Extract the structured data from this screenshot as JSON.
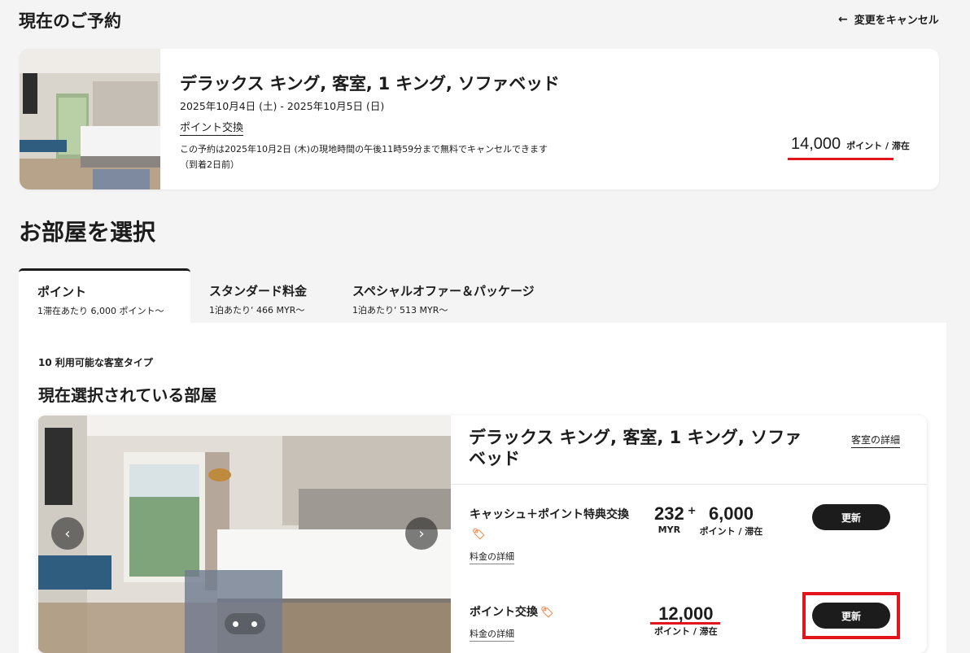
{
  "header": {
    "title": "現在のご予約",
    "cancel_label": "変更をキャンセル"
  },
  "reservation": {
    "room_name": "デラックス キング, 客室, 1 キング, ソファベッド",
    "dates": "2025年10月4日 (土) - 2025年10月5日 (日)",
    "rate_type": "ポイント交換",
    "policy": "この予約は2025年10月2日 (木)の現地時間の午後11時59分まで無料でキャンセルできます（到着2日前）",
    "price": "14,000",
    "price_unit": "ポイント / 滞在"
  },
  "select": {
    "title": "お部屋を選択",
    "tabs": [
      {
        "name": "ポイント",
        "sub": "1滞在あたり 6,000 ポイント〜"
      },
      {
        "name": "スタンダード料金",
        "sub": "1泊あたり‘ 466 MYR〜"
      },
      {
        "name": "スペシャルオファー＆パッケージ",
        "sub": "1泊あたり‘ 513 MYR〜"
      }
    ],
    "available": "10 利用可能な客室タイプ",
    "current_title": "現在選択されている部屋"
  },
  "room": {
    "name": "デラックス キング, 客室, 1 キング, ソファベッド",
    "detail_link": "客室の詳細",
    "rates": [
      {
        "name": "キャッシュ＋ポイント特典交換",
        "detail_link": "料金の詳細",
        "cash": "232",
        "cash_unit": "MYR",
        "plus": "+",
        "points": "6,000",
        "points_unit": "ポイント / 滞在",
        "button": "更新"
      },
      {
        "name": "ポイント交換",
        "detail_link": "料金の詳細",
        "points": "12,000",
        "points_unit": "ポイント / 滞在",
        "button": "更新"
      }
    ]
  },
  "colors": {
    "accent_red": "#e3141e",
    "button_dark": "#1c1c1c",
    "tag_orange": "#f08a4b"
  },
  "icons": [
    "arrow-left-icon",
    "chevron-left-icon",
    "chevron-right-icon",
    "tag-icon"
  ]
}
